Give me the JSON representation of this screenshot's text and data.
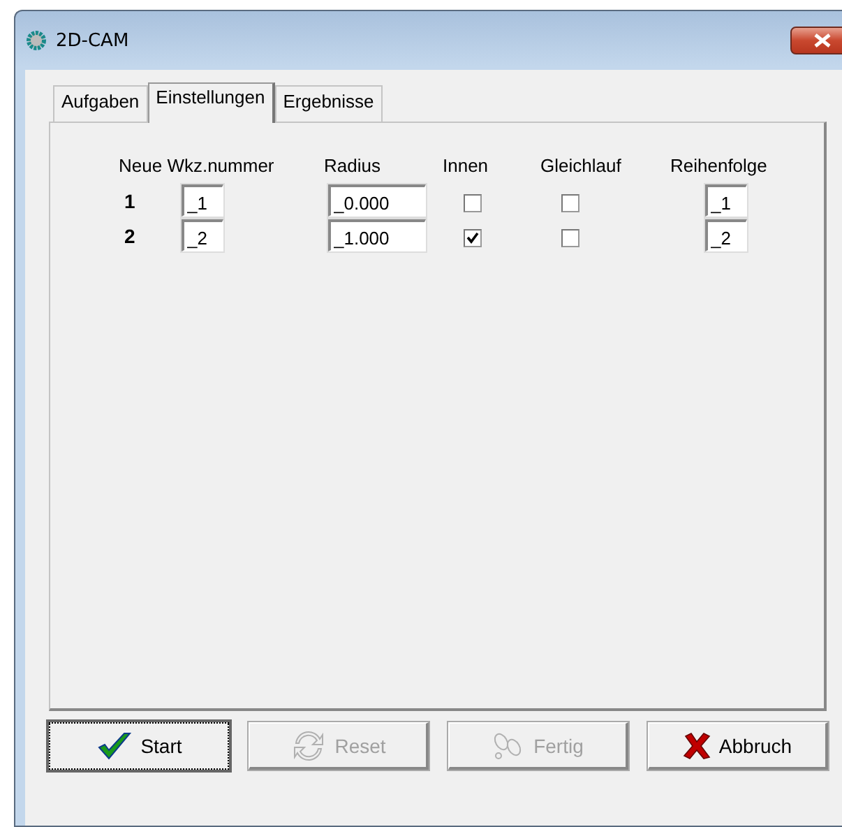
{
  "window": {
    "title": "2D-CAM"
  },
  "tabs": [
    {
      "label": "Aufgaben",
      "selected": false
    },
    {
      "label": "Einstellungen",
      "selected": true
    },
    {
      "label": "Ergebnisse",
      "selected": false
    }
  ],
  "table": {
    "columns": [
      "Neue Wkz.nummer",
      "Radius",
      "Innen",
      "Gleichlauf",
      "Reihenfolge"
    ],
    "rows": [
      {
        "number": "1",
        "tool": "_1",
        "radius": "_0.000",
        "innen": false,
        "gleichlauf": false,
        "order": "_1"
      },
      {
        "number": "2",
        "tool": "_2",
        "radius": "_1.000",
        "innen": true,
        "gleichlauf": false,
        "order": "_2"
      }
    ]
  },
  "buttons": [
    {
      "kind": "start",
      "label": "Start",
      "disabled": false,
      "focused": true
    },
    {
      "kind": "reset",
      "label": "Reset",
      "disabled": true,
      "focused": false
    },
    {
      "kind": "finish",
      "label": "Fertig",
      "disabled": true,
      "focused": false
    },
    {
      "kind": "cancel",
      "label": "Abbruch",
      "disabled": false,
      "focused": false
    }
  ]
}
